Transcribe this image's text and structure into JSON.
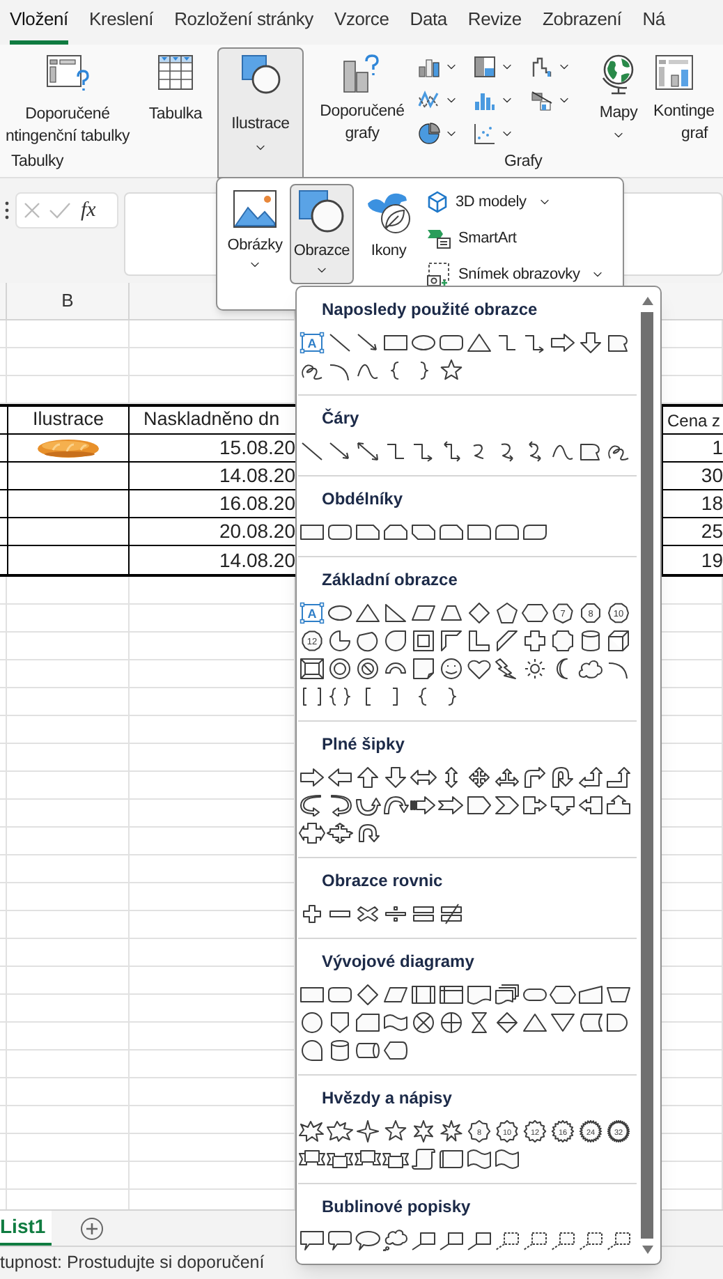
{
  "ribbon": {
    "tabs": [
      {
        "label": "Vložení",
        "selected": true
      },
      {
        "label": "Kreslení",
        "selected": false
      },
      {
        "label": "Rozložení stránky",
        "selected": false
      },
      {
        "label": "Vzorce",
        "selected": false
      },
      {
        "label": "Data",
        "selected": false
      },
      {
        "label": "Revize",
        "selected": false
      },
      {
        "label": "Zobrazení",
        "selected": false
      },
      {
        "label": "Ná",
        "selected": false
      }
    ],
    "tables_group": {
      "title": "Tabulky",
      "recommended_pivot": [
        "Doporučené",
        "ntingenční tabulky"
      ],
      "table": "Tabulka"
    },
    "illustrations": {
      "label": "Ilustrace",
      "pressed": true
    },
    "charts_group": {
      "title": "Grafy",
      "recommended_charts": [
        "Doporučené",
        "grafy"
      ],
      "maps": "Mapy",
      "pivot_chart": [
        "Kontinge",
        "graf"
      ]
    }
  },
  "formula_bar": {
    "function_label": "fx"
  },
  "illustrations_menu": {
    "items": [
      {
        "kind": "large",
        "label": "Obrázky",
        "selected": false,
        "dropdown": true
      },
      {
        "kind": "large",
        "label": "Obrazce",
        "selected": true,
        "dropdown": true
      },
      {
        "kind": "large",
        "label": "Ikony",
        "selected": false,
        "dropdown": false
      },
      {
        "kind": "small",
        "label": "3D modely",
        "dropdown": true
      },
      {
        "kind": "small",
        "label": "SmartArt",
        "dropdown": false
      },
      {
        "kind": "small",
        "label": "Snímek obrazovky",
        "dropdown": true
      }
    ]
  },
  "sheet": {
    "column_headers": [
      "B"
    ],
    "table": {
      "columns": [
        "Ilustrace",
        "Naskladněno dn",
        "Cena z"
      ],
      "rows": [
        {
          "stocked": "15.08.20",
          "price": "1"
        },
        {
          "stocked": "14.08.20",
          "price": "30"
        },
        {
          "stocked": "16.08.20",
          "price": "18"
        },
        {
          "stocked": "20.08.20",
          "price": "25"
        },
        {
          "stocked": "14.08.20",
          "price": "19"
        }
      ]
    },
    "sheet_tabs": [
      {
        "label": "List1",
        "selected": true
      }
    ]
  },
  "status_bar": "tupnost: Prostudujte si doporučení",
  "shapes_gallery": {
    "sections": [
      {
        "title": "Naposledy použité obrazce",
        "shapes": [
          {
            "kind": "textbox",
            "label": "A"
          },
          {
            "kind": "line"
          },
          {
            "kind": "arrow-line"
          },
          {
            "kind": "rect"
          },
          {
            "kind": "ellipse"
          },
          {
            "kind": "rounded-rect"
          },
          {
            "kind": "triangle"
          },
          {
            "kind": "elbow"
          },
          {
            "kind": "elbow-arrow"
          },
          {
            "kind": "arrow-right"
          },
          {
            "kind": "arrow-down"
          },
          {
            "kind": "freeform"
          },
          {
            "kind": "scribble"
          },
          {
            "kind": "arc"
          },
          {
            "kind": "curve"
          },
          {
            "kind": "left-brace"
          },
          {
            "kind": "right-brace"
          },
          {
            "kind": "star5"
          }
        ]
      },
      {
        "title": "Čáry",
        "shapes": [
          {
            "kind": "line"
          },
          {
            "kind": "arrow-line"
          },
          {
            "kind": "double-arrow"
          },
          {
            "kind": "elbow"
          },
          {
            "kind": "elbow-arrow"
          },
          {
            "kind": "elbow-double"
          },
          {
            "kind": "curve-connector"
          },
          {
            "kind": "curve-connector-arrow"
          },
          {
            "kind": "curve-connector-double"
          },
          {
            "kind": "curve"
          },
          {
            "kind": "freeform"
          },
          {
            "kind": "scribble"
          }
        ]
      },
      {
        "title": "Obdélníky",
        "shapes": [
          {
            "kind": "rect"
          },
          {
            "kind": "rounded-rect"
          },
          {
            "kind": "snip-rect"
          },
          {
            "kind": "snip-same"
          },
          {
            "kind": "snip-diag"
          },
          {
            "kind": "snip-round"
          },
          {
            "kind": "round-one"
          },
          {
            "kind": "round-same"
          },
          {
            "kind": "round-diag"
          }
        ]
      },
      {
        "title": "Základní obrazce",
        "shapes": [
          {
            "kind": "textbox",
            "label": "A"
          },
          {
            "kind": "ellipse"
          },
          {
            "kind": "triangle"
          },
          {
            "kind": "right-triangle"
          },
          {
            "kind": "parallelogram"
          },
          {
            "kind": "trapezoid"
          },
          {
            "kind": "diamond"
          },
          {
            "kind": "pentagon"
          },
          {
            "kind": "hexagon"
          },
          {
            "kind": "heptagon",
            "label": "7"
          },
          {
            "kind": "octagon",
            "label": "8"
          },
          {
            "kind": "decagon",
            "label": "10"
          },
          {
            "kind": "dodecagon",
            "label": "12"
          },
          {
            "kind": "pie"
          },
          {
            "kind": "chord"
          },
          {
            "kind": "teardrop"
          },
          {
            "kind": "frame"
          },
          {
            "kind": "half-frame"
          },
          {
            "kind": "l-shape"
          },
          {
            "kind": "diagonal-stripe"
          },
          {
            "kind": "cross"
          },
          {
            "kind": "plaque"
          },
          {
            "kind": "can"
          },
          {
            "kind": "cube"
          },
          {
            "kind": "bevel"
          },
          {
            "kind": "donut"
          },
          {
            "kind": "no-symbol"
          },
          {
            "kind": "block-arc"
          },
          {
            "kind": "folded-corner"
          },
          {
            "kind": "smiley"
          },
          {
            "kind": "heart"
          },
          {
            "kind": "lightning"
          },
          {
            "kind": "sun"
          },
          {
            "kind": "moon"
          },
          {
            "kind": "cloud"
          },
          {
            "kind": "arc"
          },
          {
            "kind": "bracket-pair"
          },
          {
            "kind": "brace-pair"
          },
          {
            "kind": "left-bracket"
          },
          {
            "kind": "right-bracket"
          },
          {
            "kind": "left-brace"
          },
          {
            "kind": "right-brace"
          }
        ]
      },
      {
        "title": "Plné šipky",
        "shapes": [
          {
            "kind": "arrow-right"
          },
          {
            "kind": "arrow-left"
          },
          {
            "kind": "arrow-up"
          },
          {
            "kind": "arrow-down"
          },
          {
            "kind": "arrow-left-right"
          },
          {
            "kind": "arrow-up-down"
          },
          {
            "kind": "quad-arrow"
          },
          {
            "kind": "left-right-up-arrow"
          },
          {
            "kind": "bent-arrow"
          },
          {
            "kind": "u-turn-arrow"
          },
          {
            "kind": "left-up-arrow"
          },
          {
            "kind": "bent-up-arrow"
          },
          {
            "kind": "curved-right-arrow"
          },
          {
            "kind": "curved-left-arrow"
          },
          {
            "kind": "curved-up-arrow"
          },
          {
            "kind": "curved-down-arrow"
          },
          {
            "kind": "striped-arrow"
          },
          {
            "kind": "notched-arrow"
          },
          {
            "kind": "home-plate"
          },
          {
            "kind": "chevron"
          },
          {
            "kind": "right-arrow-callout"
          },
          {
            "kind": "down-arrow-callout"
          },
          {
            "kind": "left-arrow-callout"
          },
          {
            "kind": "up-arrow-callout"
          },
          {
            "kind": "left-right-arrow-callout"
          },
          {
            "kind": "quad-arrow-callout"
          },
          {
            "kind": "circular-arrow"
          }
        ]
      },
      {
        "title": "Obrazce rovnic",
        "shapes": [
          {
            "kind": "plus"
          },
          {
            "kind": "minus"
          },
          {
            "kind": "multiply"
          },
          {
            "kind": "divide"
          },
          {
            "kind": "equal"
          },
          {
            "kind": "not-equal"
          }
        ]
      },
      {
        "title": "Vývojové diagramy",
        "shapes": [
          {
            "kind": "rect"
          },
          {
            "kind": "rounded-rect"
          },
          {
            "kind": "diamond"
          },
          {
            "kind": "parallelogram"
          },
          {
            "kind": "predefined-process"
          },
          {
            "kind": "internal-storage"
          },
          {
            "kind": "document"
          },
          {
            "kind": "multidocument"
          },
          {
            "kind": "terminator"
          },
          {
            "kind": "hexagon"
          },
          {
            "kind": "manual-input"
          },
          {
            "kind": "manual-operation"
          },
          {
            "kind": "circle"
          },
          {
            "kind": "off-page"
          },
          {
            "kind": "card"
          },
          {
            "kind": "punched-tape"
          },
          {
            "kind": "summing-junction"
          },
          {
            "kind": "or-symbol"
          },
          {
            "kind": "collate"
          },
          {
            "kind": "sort"
          },
          {
            "kind": "triangle"
          },
          {
            "kind": "merge"
          },
          {
            "kind": "stored-data"
          },
          {
            "kind": "delay"
          },
          {
            "kind": "sequential-storage"
          },
          {
            "kind": "can"
          },
          {
            "kind": "direct-access"
          },
          {
            "kind": "display"
          }
        ]
      },
      {
        "title": "Hvězdy a nápisy",
        "shapes": [
          {
            "kind": "explosion"
          },
          {
            "kind": "explosion-two"
          },
          {
            "kind": "star4"
          },
          {
            "kind": "star5"
          },
          {
            "kind": "star6"
          },
          {
            "kind": "star7"
          },
          {
            "kind": "seal8",
            "label": "8"
          },
          {
            "kind": "seal10",
            "label": "10"
          },
          {
            "kind": "seal12",
            "label": "12"
          },
          {
            "kind": "seal16",
            "label": "16"
          },
          {
            "kind": "seal24",
            "label": "24"
          },
          {
            "kind": "seal32",
            "label": "32"
          },
          {
            "kind": "ribbon"
          },
          {
            "kind": "ribbon-down"
          },
          {
            "kind": "ribbon"
          },
          {
            "kind": "ribbon-down"
          },
          {
            "kind": "vertical-scroll"
          },
          {
            "kind": "horizontal-scroll"
          },
          {
            "kind": "wave"
          },
          {
            "kind": "wave"
          }
        ]
      },
      {
        "title": "Bublinové popisky",
        "shapes": [
          {
            "kind": "callout-rect"
          },
          {
            "kind": "callout-rounded"
          },
          {
            "kind": "callout-oval"
          },
          {
            "kind": "callout-cloud"
          },
          {
            "kind": "line-callout"
          },
          {
            "kind": "line-callout"
          },
          {
            "kind": "line-callout"
          },
          {
            "kind": "line-callout-dashed"
          },
          {
            "kind": "line-callout-dashed"
          },
          {
            "kind": "line-callout-dashed"
          },
          {
            "kind": "line-callout-dashed"
          },
          {
            "kind": "line-callout-dashed"
          }
        ]
      }
    ]
  }
}
